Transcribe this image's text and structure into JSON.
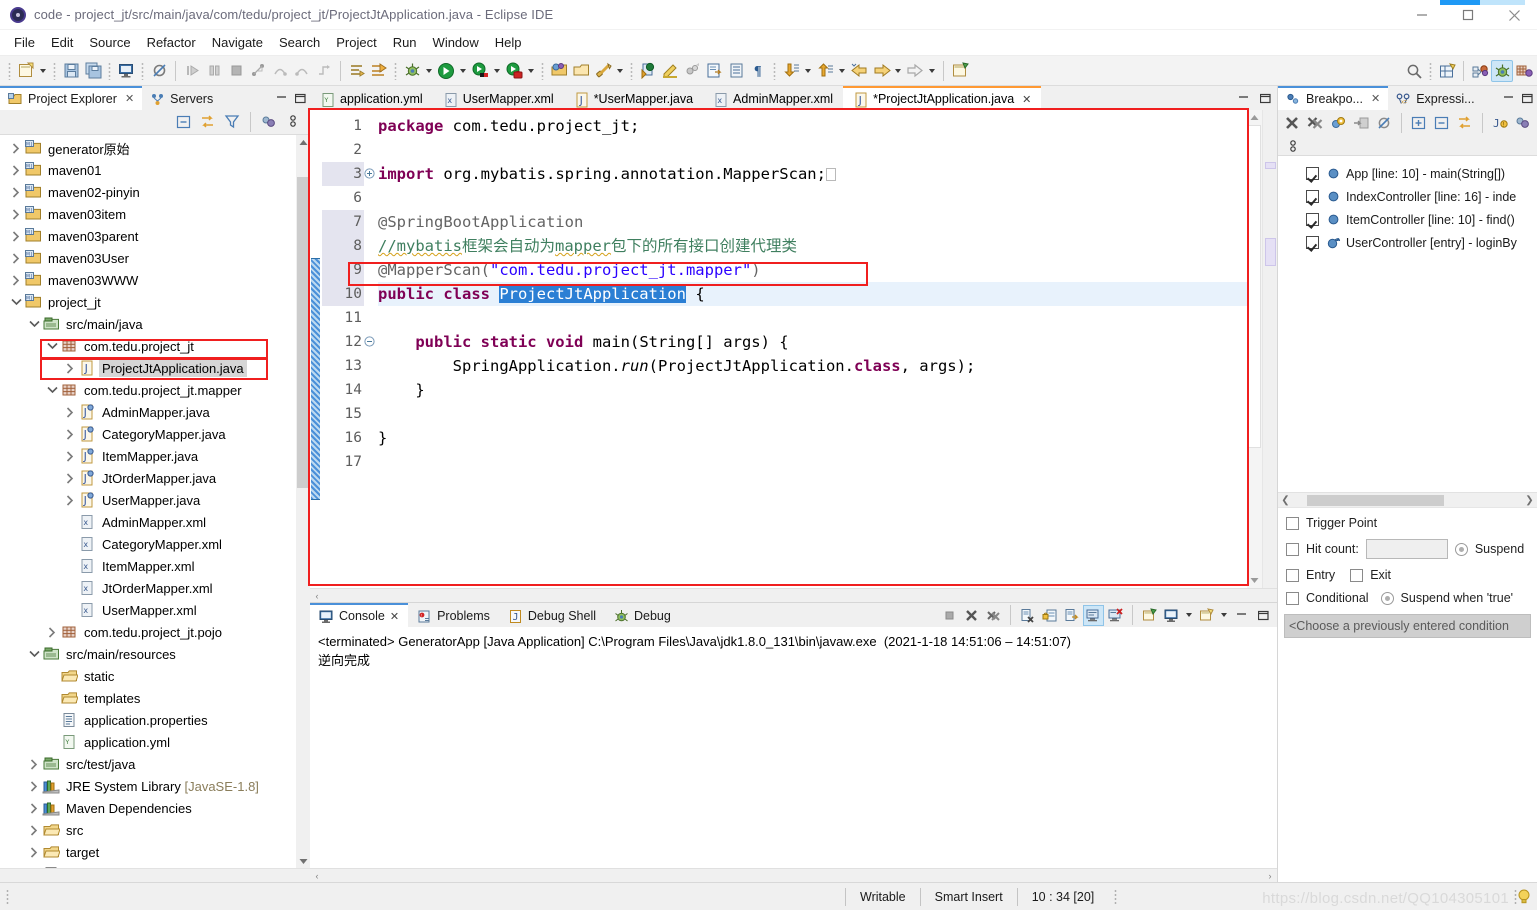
{
  "window": {
    "title": "code - project_jt/src/main/java/com/tedu/project_jt/ProjectJtApplication.java - Eclipse IDE",
    "app_icon": "eclipse-icon",
    "minimize": "minimize-icon",
    "maximize": "maximize-icon",
    "close": "close-icon",
    "accent": "#4a90d9",
    "highlight_box_color": "#f01f1f"
  },
  "menubar": {
    "items": [
      "File",
      "Edit",
      "Source",
      "Refactor",
      "Navigate",
      "Search",
      "Project",
      "Run",
      "Window",
      "Help"
    ]
  },
  "toolbar": {
    "groups": [
      {
        "items": [
          {
            "name": "new-wizard-icon",
            "arrow": true
          },
          {
            "name": "save-icon"
          },
          {
            "name": "save-all-icon"
          },
          {
            "name": "open-console-icon"
          },
          {
            "name": "skip-breakpoints-icon"
          }
        ]
      },
      {
        "items": [
          {
            "name": "resume-icon"
          },
          {
            "name": "suspend-icon"
          },
          {
            "name": "terminate-icon"
          },
          {
            "name": "step-into-icon"
          },
          {
            "name": "step-over-icon"
          },
          {
            "name": "step-return-icon"
          },
          {
            "name": "drop-to-frame-icon"
          }
        ]
      },
      {
        "items": [
          {
            "name": "next-annotation-icon"
          },
          {
            "name": "previous-annotation-icon"
          }
        ]
      },
      {
        "items": [
          {
            "name": "debug-icon",
            "arrow": true
          },
          {
            "name": "run-icon",
            "arrow": true
          },
          {
            "name": "run-external-tools-icon",
            "arrow": true
          },
          {
            "name": "coverage-icon",
            "arrow": true
          }
        ]
      },
      {
        "items": [
          {
            "name": "new-java-package-icon"
          },
          {
            "name": "new-java-class-icon"
          },
          {
            "name": "new-annotation-icon",
            "arrow": true
          }
        ]
      },
      {
        "items": [
          {
            "name": "open-type-icon"
          },
          {
            "name": "toggle-mark-occurrences-icon"
          },
          {
            "name": "build-all-icon"
          },
          {
            "name": "open-task-icon"
          },
          {
            "name": "show-whitespace-icon"
          },
          {
            "name": "pilcrow-icon"
          }
        ]
      },
      {
        "items": [
          {
            "name": "next-edit-location-icon",
            "arrow": true
          },
          {
            "name": "previous-edit-location-icon",
            "arrow": true
          },
          {
            "name": "back-icon",
            "arrow": true
          },
          {
            "name": "forward-icon",
            "arrow": true
          }
        ]
      },
      {
        "items": [
          {
            "name": "new-window-icon"
          }
        ]
      }
    ],
    "right_items": [
      {
        "name": "search-icon"
      },
      {
        "name": "open-perspective-icon"
      },
      {
        "name": "java-perspective-icon"
      },
      {
        "name": "debug-perspective-icon",
        "selected": true
      },
      {
        "name": "java-ee-perspective-icon"
      }
    ]
  },
  "left_panel": {
    "tabs": [
      {
        "label": "Project Explorer",
        "icon": "project-explorer-icon",
        "active": true,
        "closable": true
      },
      {
        "label": "Servers",
        "icon": "servers-icon",
        "active": false,
        "closable": false
      }
    ],
    "window_buttons": [
      "minimize-icon",
      "maximize-icon"
    ],
    "actions": [
      {
        "name": "collapse-all-icon"
      },
      {
        "name": "link-with-editor-icon"
      },
      {
        "name": "filters-icon"
      },
      {
        "name": "working-sets-icon"
      },
      {
        "name": "view-menu-icon"
      }
    ],
    "tree": [
      {
        "label": "generator原始",
        "icon": "maven-project-icon",
        "depth": 0,
        "twist": "collapsed"
      },
      {
        "label": "maven01",
        "icon": "maven-project-icon",
        "depth": 0,
        "twist": "collapsed"
      },
      {
        "label": "maven02-pinyin",
        "icon": "maven-project-icon",
        "depth": 0,
        "twist": "collapsed"
      },
      {
        "label": "maven03item",
        "icon": "maven-project-icon",
        "depth": 0,
        "twist": "collapsed"
      },
      {
        "label": "maven03parent",
        "icon": "maven-project-icon",
        "depth": 0,
        "twist": "collapsed"
      },
      {
        "label": "maven03User",
        "icon": "maven-project-icon",
        "depth": 0,
        "twist": "collapsed"
      },
      {
        "label": "maven03WWW",
        "icon": "maven-project-icon",
        "depth": 0,
        "twist": "collapsed"
      },
      {
        "label": "project_jt",
        "icon": "maven-project-icon",
        "depth": 0,
        "twist": "expanded"
      },
      {
        "label": "src/main/java",
        "icon": "source-folder-icon",
        "depth": 1,
        "twist": "expanded"
      },
      {
        "label": "com.tedu.project_jt",
        "icon": "package-icon",
        "depth": 2,
        "twist": "expanded",
        "highlighted": true
      },
      {
        "label": "ProjectJtApplication.java",
        "icon": "java-file-icon",
        "depth": 3,
        "twist": "collapsed",
        "selected": true,
        "highlighted": true
      },
      {
        "label": "com.tedu.project_jt.mapper",
        "icon": "package-icon",
        "depth": 2,
        "twist": "expanded"
      },
      {
        "label": "AdminMapper.java",
        "icon": "java-interface-icon",
        "depth": 3,
        "twist": "collapsed"
      },
      {
        "label": "CategoryMapper.java",
        "icon": "java-interface-icon",
        "depth": 3,
        "twist": "collapsed"
      },
      {
        "label": "ItemMapper.java",
        "icon": "java-interface-icon",
        "depth": 3,
        "twist": "collapsed"
      },
      {
        "label": "JtOrderMapper.java",
        "icon": "java-interface-icon",
        "depth": 3,
        "twist": "collapsed"
      },
      {
        "label": "UserMapper.java",
        "icon": "java-interface-icon",
        "depth": 3,
        "twist": "collapsed"
      },
      {
        "label": "AdminMapper.xml",
        "icon": "xml-file-icon",
        "depth": 3,
        "twist": "none"
      },
      {
        "label": "CategoryMapper.xml",
        "icon": "xml-file-icon",
        "depth": 3,
        "twist": "none"
      },
      {
        "label": "ItemMapper.xml",
        "icon": "xml-file-icon",
        "depth": 3,
        "twist": "none"
      },
      {
        "label": "JtOrderMapper.xml",
        "icon": "xml-file-icon",
        "depth": 3,
        "twist": "none"
      },
      {
        "label": "UserMapper.xml",
        "icon": "xml-file-icon",
        "depth": 3,
        "twist": "none"
      },
      {
        "label": "com.tedu.project_jt.pojo",
        "icon": "package-icon",
        "depth": 2,
        "twist": "collapsed"
      },
      {
        "label": "src/main/resources",
        "icon": "source-folder-icon",
        "depth": 1,
        "twist": "expanded"
      },
      {
        "label": "static",
        "icon": "folder-icon",
        "depth": 2,
        "twist": "none"
      },
      {
        "label": "templates",
        "icon": "folder-icon",
        "depth": 2,
        "twist": "none"
      },
      {
        "label": "application.properties",
        "icon": "properties-file-icon",
        "depth": 2,
        "twist": "none"
      },
      {
        "label": "application.yml",
        "icon": "yml-file-icon",
        "depth": 2,
        "twist": "none"
      },
      {
        "label": "src/test/java",
        "icon": "source-folder-icon",
        "depth": 1,
        "twist": "collapsed"
      },
      {
        "label": "JRE System Library",
        "suffix": "[JavaSE-1.8]",
        "icon": "library-icon",
        "depth": 1,
        "twist": "collapsed"
      },
      {
        "label": "Maven Dependencies",
        "icon": "library-icon",
        "depth": 1,
        "twist": "collapsed"
      },
      {
        "label": "src",
        "icon": "folder-icon",
        "depth": 1,
        "twist": "collapsed"
      },
      {
        "label": "target",
        "icon": "folder-icon",
        "depth": 1,
        "twist": "collapsed"
      },
      {
        "label": "HELP.md",
        "icon": "markdown-file-icon",
        "depth": 1,
        "twist": "none"
      }
    ]
  },
  "editor": {
    "tabs": [
      {
        "label": "application.yml",
        "icon": "yml-file-icon",
        "active": false,
        "dirty": false
      },
      {
        "label": "UserMapper.xml",
        "icon": "xml-file-icon",
        "active": false,
        "dirty": false
      },
      {
        "label": "*UserMapper.java",
        "icon": "java-file-icon",
        "active": false,
        "dirty": true
      },
      {
        "label": "AdminMapper.xml",
        "icon": "xml-file-icon",
        "active": false,
        "dirty": false
      },
      {
        "label": "*ProjectJtApplication.java",
        "icon": "java-file-icon",
        "active": true,
        "dirty": true,
        "closable": true
      }
    ],
    "window_buttons": [
      "minimize-icon",
      "maximize-icon"
    ],
    "line_numbers": [
      "1",
      "2",
      "3",
      "6",
      "7",
      "8",
      "9",
      "10",
      "11",
      "12",
      "13",
      "14",
      "15",
      "16",
      "17"
    ],
    "fold_markers": {
      "3": "+",
      "12": "-"
    },
    "current_line": "10",
    "changed_lines_from": "7",
    "changed_lines_to": "16",
    "code_lines": [
      {
        "n": "1",
        "text": "package com.tedu.project_jt;"
      },
      {
        "n": "2",
        "text": ""
      },
      {
        "n": "3",
        "text": "import org.mybatis.spring.annotation.MapperScan;"
      },
      {
        "n": "6",
        "text": ""
      },
      {
        "n": "7",
        "text": "@SpringBootApplication"
      },
      {
        "n": "8",
        "text": "//mybatis框架会自动为mapper包下的所有接口创建代理类"
      },
      {
        "n": "9",
        "text": "@MapperScan(\"com.tedu.project_jt.mapper\")"
      },
      {
        "n": "10",
        "text": "public class ProjectJtApplication {"
      },
      {
        "n": "11",
        "text": ""
      },
      {
        "n": "12",
        "text": "    public static void main(String[] args) {"
      },
      {
        "n": "13",
        "text": "        SpringApplication.run(ProjectJtApplication.class, args);"
      },
      {
        "n": "14",
        "text": "    }"
      },
      {
        "n": "15",
        "text": ""
      },
      {
        "n": "16",
        "text": "}"
      },
      {
        "n": "17",
        "text": ""
      }
    ]
  },
  "console": {
    "tabs": [
      {
        "label": "Console",
        "icon": "console-icon",
        "active": true,
        "closable": true
      },
      {
        "label": "Problems",
        "icon": "problems-icon",
        "active": false
      },
      {
        "label": "Debug Shell",
        "icon": "debug-shell-icon",
        "active": false
      },
      {
        "label": "Debug",
        "icon": "debug-icon",
        "active": false
      }
    ],
    "tools": [
      {
        "name": "terminate-icon"
      },
      {
        "name": "remove-launch-icon"
      },
      {
        "name": "remove-all-terminated-icon"
      },
      {
        "name": "clear-console-icon"
      },
      {
        "name": "scroll-lock-icon"
      },
      {
        "name": "word-wrap-icon"
      },
      {
        "name": "show-console-on-output-icon",
        "selected": true
      },
      {
        "name": "show-console-on-error-icon"
      },
      {
        "name": "pin-console-icon"
      },
      {
        "name": "display-selected-console-icon",
        "arrow": true
      },
      {
        "name": "open-console-icon",
        "arrow": true
      },
      {
        "name": "minimize-icon"
      },
      {
        "name": "maximize-icon"
      }
    ],
    "header": "<terminated> GeneratorApp [Java Application] C:\\Program Files\\Java\\jdk1.8.0_131\\bin\\javaw.exe  (2021-1-18 14:51:06 – 14:51:07)",
    "output": "逆向完成"
  },
  "right_panel": {
    "tabs": [
      {
        "label": "Breakpo...",
        "icon": "breakpoints-icon",
        "active": true,
        "closable": true
      },
      {
        "label": "Expressi...",
        "icon": "expressions-icon",
        "active": false
      }
    ],
    "window_buttons": [
      "minimize-icon",
      "maximize-icon"
    ],
    "tools": [
      {
        "name": "remove-breakpoint-icon"
      },
      {
        "name": "remove-all-breakpoints-icon"
      },
      {
        "name": "skip-all-breakpoints-icon"
      },
      {
        "name": "link-with-debug-view-icon"
      },
      {
        "name": "disable-breakpoint-icon"
      },
      {
        "name": "expand-all-icon"
      },
      {
        "name": "collapse-all-icon"
      },
      {
        "name": "link-with-editor-icon"
      },
      {
        "name": "add-java-exception-breakpoint-icon"
      },
      {
        "name": "working-sets-icon"
      },
      {
        "name": "view-menu-icon"
      }
    ],
    "breakpoints": [
      {
        "checked": true,
        "icon": "line-breakpoint-icon",
        "label": "App [line: 10] - main(String[])"
      },
      {
        "checked": true,
        "icon": "line-breakpoint-icon",
        "label": "IndexController [line: 16] - inde"
      },
      {
        "checked": true,
        "icon": "line-breakpoint-icon",
        "label": "ItemController [line: 10] - find()"
      },
      {
        "checked": true,
        "icon": "method-breakpoint-icon",
        "label": "UserController [entry] - loginBy"
      }
    ],
    "detail": {
      "trigger_point_label": "Trigger Point",
      "trigger_point_checked": false,
      "hit_count_label": "Hit count:",
      "hit_count_checked": false,
      "hit_count_value": "",
      "suspend_label": "Suspend",
      "entry_label": "Entry",
      "entry_checked": false,
      "exit_label": "Exit",
      "exit_checked": false,
      "conditional_label": "Conditional",
      "conditional_checked": false,
      "suspend_when_true_label": "Suspend when 'true'",
      "condition_placeholder": "<Choose a previously entered condition"
    }
  },
  "statusbar": {
    "writable": "Writable",
    "insert_mode": "Smart Insert",
    "position": "10 : 34 [20]",
    "watermark": "https://blog.csdn.net/QQ104305101",
    "bulb": "quick-fix-bulb-icon"
  }
}
